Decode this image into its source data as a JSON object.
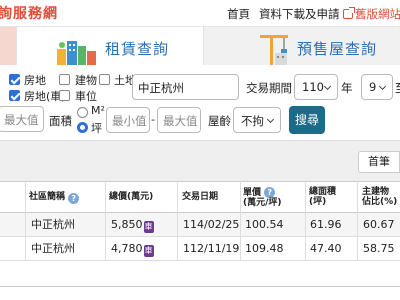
{
  "header": {
    "brand": "詢服務網",
    "nav": {
      "home": "首頁",
      "download": "資料下載及申請",
      "old_site": "舊版網站"
    }
  },
  "tabs": [
    {
      "label": "租賃查詢",
      "active": true
    },
    {
      "label": "預售屋查詢",
      "active": false
    }
  ],
  "filters": {
    "property_types": [
      {
        "label": "房地",
        "checked": true
      },
      {
        "label": "建物",
        "checked": false
      },
      {
        "label": "土地",
        "checked": false
      },
      {
        "label": "房地(車)",
        "checked": true
      },
      {
        "label": "車位",
        "checked": false
      }
    ],
    "community_name": "中正杭州",
    "period_label": "交易期間：",
    "year_value": "110",
    "year_unit": "年",
    "month_value": "9",
    "to_label": "至",
    "max_value_placeholder": "最大值",
    "area_label": "面積",
    "area_unit_m2": "M²",
    "area_unit_ping": "坪",
    "area_min_placeholder": "最小值",
    "area_dash": "-",
    "area_max_placeholder": "最大值",
    "age_label": "屋齡",
    "age_value": "不拘",
    "search_label": "搜尋"
  },
  "pagination": {
    "first_label": "首筆"
  },
  "table": {
    "columns": [
      "社區簡稱",
      "總價(萬元)",
      "交易日期",
      "單價(萬元/坪)",
      "總面積(坪)",
      "主建物佔比(%)"
    ],
    "column_labels": {
      "community": "社區簡稱",
      "price": "總價(萬元)",
      "date": "交易日期",
      "unit_price_1": "單價",
      "unit_price_2": "(萬元/坪)",
      "area_1": "總面積",
      "area_2": "(坪)",
      "ratio_1": "主建物",
      "ratio_2": "佔比(%)"
    },
    "rows": [
      {
        "community": "中正杭州",
        "price": "5,850",
        "badge": "車",
        "date": "114/02/25",
        "unit_price": "100.54",
        "area": "61.96",
        "ratio": "60.67"
      },
      {
        "community": "中正杭州",
        "price": "4,780",
        "badge": "車",
        "date": "112/11/19",
        "unit_price": "109.48",
        "area": "47.40",
        "ratio": "58.75"
      }
    ]
  },
  "colors": {
    "brand": "#e24d3a",
    "tab_text": "#2a6fb5",
    "search_button": "#1d6b88",
    "badge": "#6d3b8e",
    "checkbox": "#2f6fd6"
  }
}
